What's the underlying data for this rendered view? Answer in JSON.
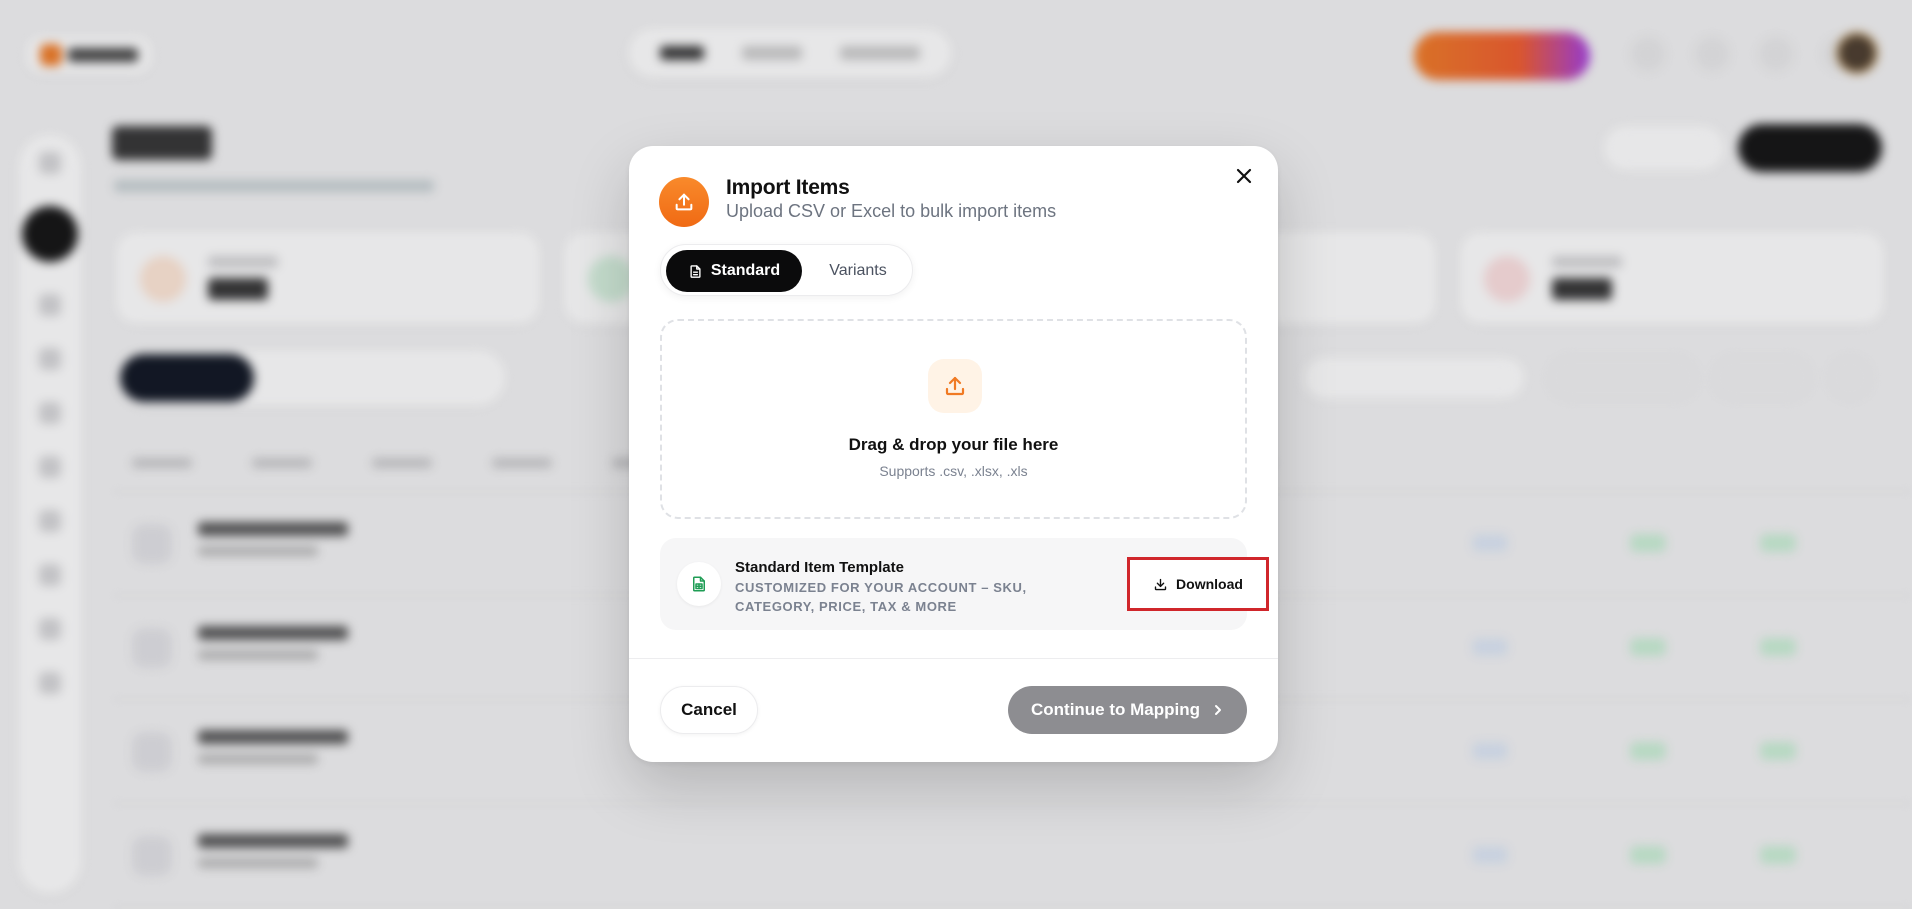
{
  "modal": {
    "title": "Import Items",
    "subtitle": "Upload CSV or Excel to bulk import items",
    "tabs": [
      {
        "label": "Standard",
        "active": true
      },
      {
        "label": "Variants",
        "active": false
      }
    ],
    "dropzone": {
      "title": "Drag & drop your file here",
      "subtitle": "Supports .csv, .xlsx, .xls"
    },
    "template": {
      "title": "Standard Item Template",
      "description": "CUSTOMIZED FOR YOUR ACCOUNT – SKU, CATEGORY, PRICE, TAX & MORE",
      "download_label": "Download"
    },
    "footer": {
      "cancel_label": "Cancel",
      "continue_label": "Continue to Mapping"
    }
  },
  "colors": {
    "accent_orange": "#f07a24",
    "primary_dark": "#0b0b0c",
    "highlight_red": "#d0262b",
    "disabled_gray": "#8d8d91",
    "template_green": "#1f9d55"
  },
  "icons": {
    "header": "upload-icon",
    "close": "close-icon",
    "standard_tab": "document-icon",
    "dropzone": "upload-icon",
    "template": "spreadsheet-icon",
    "download": "download-icon",
    "continue": "chevron-right-icon"
  }
}
